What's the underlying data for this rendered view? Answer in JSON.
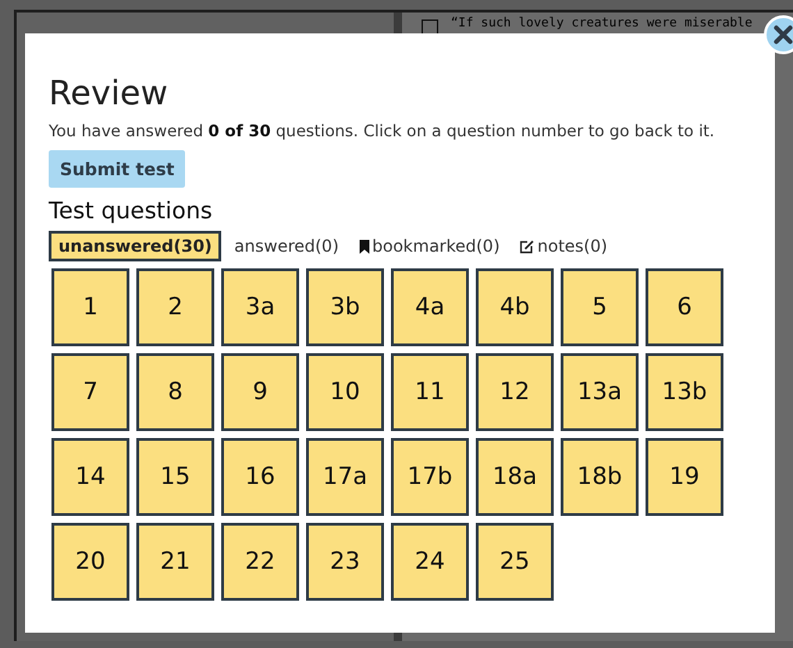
{
  "background_page": {
    "checked": false,
    "text": "“If such lovely creatures were miserable"
  },
  "dialog": {
    "title": "Review",
    "summary": "You have answered **0 of 30** questions. Click on a question number to go back to it.",
    "submit_button": "Submit test",
    "section_title": "Test questions",
    "filters": [
      {
        "label": "unanswered(30)",
        "kind": "plain",
        "selected": true
      },
      {
        "label": "answered(0)",
        "kind": "plain",
        "selected": false
      },
      {
        "label": "bookmarked(0)",
        "kind": "bookmark",
        "selected": false
      },
      {
        "label": "notes(0)",
        "kind": "note",
        "selected": false
      }
    ],
    "questions": [
      {
        "label": "1",
        "answered": false
      },
      {
        "label": "2",
        "answered": false
      },
      {
        "label": "3a",
        "answered": false
      },
      {
        "label": "3b",
        "answered": false
      },
      {
        "label": "4a",
        "answered": false
      },
      {
        "label": "4b",
        "answered": false
      },
      {
        "label": "5",
        "answered": false
      },
      {
        "label": "6",
        "answered": false
      },
      {
        "label": "7",
        "answered": false
      },
      {
        "label": "8",
        "answered": false
      },
      {
        "label": "9",
        "answered": false
      },
      {
        "label": "10",
        "answered": false
      },
      {
        "label": "11",
        "answered": false
      },
      {
        "label": "12",
        "answered": false
      },
      {
        "label": "13a",
        "answered": false
      },
      {
        "label": "13b",
        "answered": false
      },
      {
        "label": "14",
        "answered": false
      },
      {
        "label": "15",
        "answered": false
      },
      {
        "label": "16",
        "answered": false
      },
      {
        "label": "17a",
        "answered": false
      },
      {
        "label": "17b",
        "answered": false
      },
      {
        "label": "18a",
        "answered": false
      },
      {
        "label": "18b",
        "answered": false
      },
      {
        "label": "19",
        "answered": false
      },
      {
        "label": "20",
        "answered": false
      },
      {
        "label": "21",
        "answered": false
      },
      {
        "label": "22",
        "answered": false
      },
      {
        "label": "23",
        "answered": false
      },
      {
        "label": "24",
        "answered": false
      },
      {
        "label": "25",
        "answered": false
      }
    ]
  }
}
